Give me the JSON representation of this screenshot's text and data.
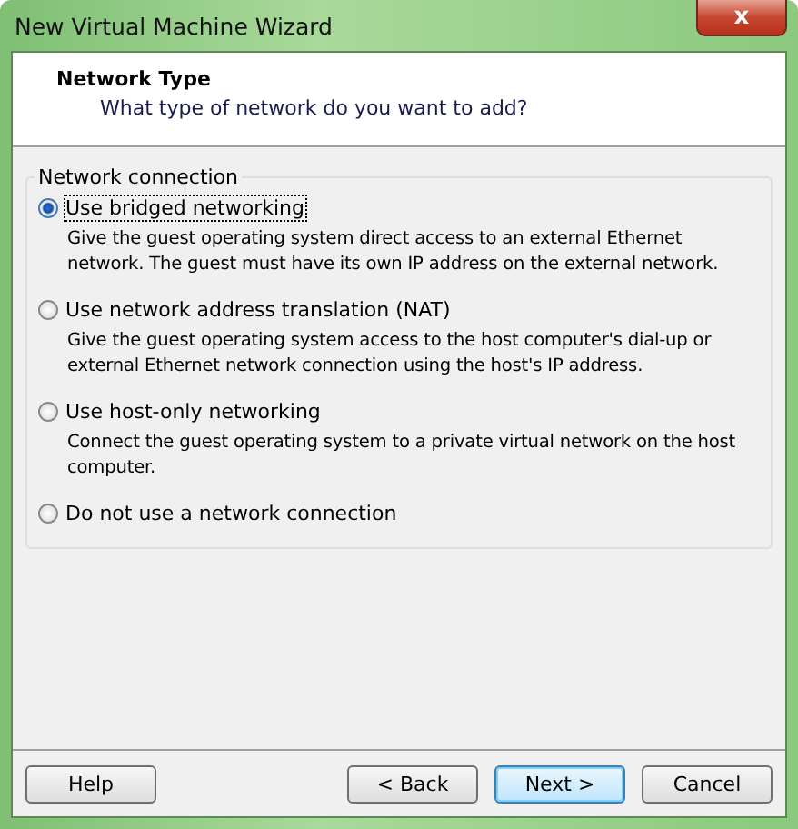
{
  "window": {
    "title": "New Virtual Machine Wizard",
    "close_glyph": "x"
  },
  "header": {
    "title": "Network Type",
    "subtitle": "What type of network do you want to add?"
  },
  "group": {
    "title": "Network connection",
    "options": [
      {
        "label": "Use bridged networking",
        "description": "Give the guest operating system direct access to an external Ethernet network. The guest must have its own IP address on the external network.",
        "selected": true
      },
      {
        "label": "Use network address translation (NAT)",
        "description": "Give the guest operating system access to the host computer's dial-up or external Ethernet network connection using the host's IP address.",
        "selected": false
      },
      {
        "label": "Use host-only networking",
        "description": "Connect the guest operating system to a private virtual network on the host computer.",
        "selected": false
      },
      {
        "label": "Do not use a network connection",
        "selected": false
      }
    ]
  },
  "buttons": [
    {
      "label": "Help",
      "kind": "left",
      "default": false
    },
    {
      "label": "< Back",
      "kind": "right",
      "default": false
    },
    {
      "label": "Next >",
      "kind": "right",
      "default": true
    },
    {
      "label": "Cancel",
      "kind": "right",
      "default": false
    }
  ]
}
